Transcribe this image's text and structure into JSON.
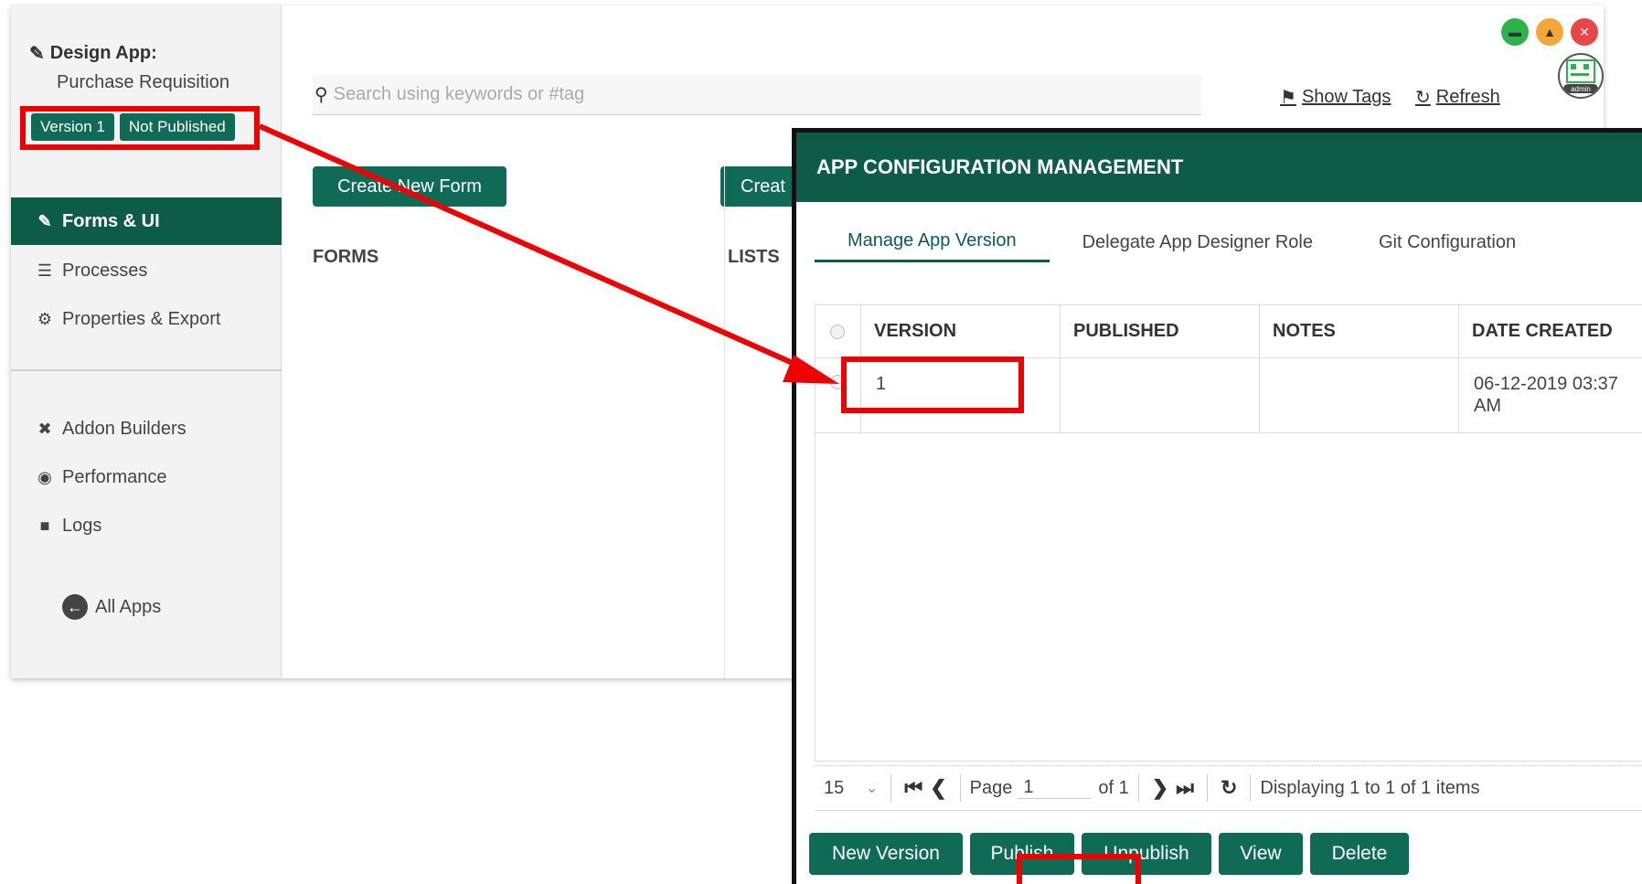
{
  "sidebar": {
    "app_title": "Design App:",
    "app_name": "Purchase Requisition",
    "version_badge": "Version 1",
    "publish_badge": "Not Published",
    "nav": [
      {
        "label": "Forms & UI",
        "icon": "edit-icon"
      },
      {
        "label": "Processes",
        "icon": "list-icon"
      },
      {
        "label": "Properties & Export",
        "icon": "gear-icon"
      }
    ],
    "tools": [
      {
        "label": "Addon Builders",
        "icon": "tools-icon"
      },
      {
        "label": "Performance",
        "icon": "dashboard-icon"
      },
      {
        "label": "Logs",
        "icon": "scroll-icon"
      }
    ],
    "all_apps": "All Apps"
  },
  "header": {
    "search_placeholder": "Search using keywords or #tag",
    "show_tags": "Show Tags",
    "refresh": "Refresh",
    "avatar_label": "admin"
  },
  "main": {
    "create_form": "Create New Form",
    "create_list": "Creat",
    "forms_heading": "FORMS",
    "lists_heading": "LISTS"
  },
  "dialog": {
    "title": "APP CONFIGURATION MANAGEMENT",
    "tabs": [
      "Manage App Version",
      "Delegate App Designer Role",
      "Git Configuration"
    ],
    "columns": [
      "VERSION",
      "PUBLISHED",
      "NOTES",
      "DATE CREATED"
    ],
    "rows": [
      {
        "version": "1",
        "published": "",
        "notes": "",
        "date_created": "06-12-2019 03:37 AM"
      }
    ],
    "pager": {
      "page_size": "15",
      "page_label": "Page",
      "page_value": "1",
      "of_label": "of 1",
      "display_text": "Displaying 1 to 1 of 1 items"
    },
    "buttons": {
      "new_version": "New Version",
      "publish": "Publish",
      "unpublish": "Unpublish",
      "view": "View",
      "delete": "Delete"
    }
  },
  "colors": {
    "brand_green": "#0f6b55",
    "dark_green": "#0d5c48",
    "annotation_red": "#ee0000"
  }
}
